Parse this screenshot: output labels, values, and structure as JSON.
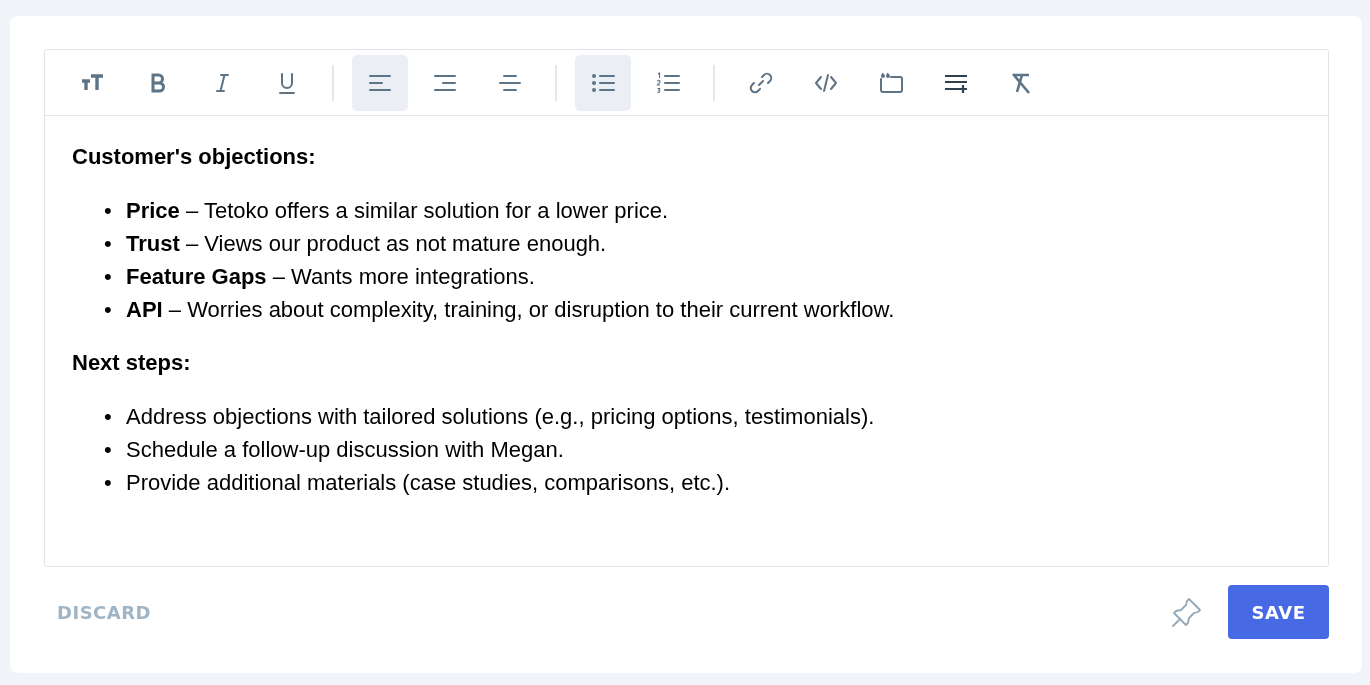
{
  "toolbar": {
    "groups": [
      {
        "buttons": [
          {
            "kind": "text-size",
            "selected": false
          },
          {
            "kind": "bold",
            "selected": false
          },
          {
            "kind": "italic",
            "selected": false
          },
          {
            "kind": "underline",
            "selected": false
          }
        ]
      },
      {
        "buttons": [
          {
            "kind": "align-left",
            "selected": true
          },
          {
            "kind": "align-right",
            "selected": false
          },
          {
            "kind": "align-center",
            "selected": false
          }
        ]
      },
      {
        "buttons": [
          {
            "kind": "bullet-list",
            "selected": true
          },
          {
            "kind": "numbered-list",
            "selected": false
          }
        ]
      },
      {
        "buttons": [
          {
            "kind": "link",
            "selected": false
          },
          {
            "kind": "code",
            "selected": false
          },
          {
            "kind": "quote",
            "selected": false
          },
          {
            "kind": "insert-line",
            "selected": false
          },
          {
            "kind": "clear-format",
            "selected": false
          }
        ]
      }
    ]
  },
  "content": [
    {
      "kind": "heading",
      "text": "Customer's objections:"
    },
    {
      "kind": "list",
      "items": [
        {
          "marker": "•",
          "text": "**Price** – Tetoko offers a similar solution for a lower price."
        },
        {
          "marker": "•",
          "text": "**Trust** – Views our product as not mature enough."
        },
        {
          "marker": "•",
          "text": "**Feature Gaps** – Wants more integrations."
        },
        {
          "marker": "•",
          "text": "**API** – Worries about complexity, training, or disruption to their current workflow."
        }
      ]
    },
    {
      "kind": "heading",
      "text": "Next steps:"
    },
    {
      "kind": "list",
      "items": [
        {
          "marker": "•",
          "text": "Address objections with tailored solutions (e.g., pricing options, testimonials)."
        },
        {
          "marker": "•",
          "text": "Schedule a follow-up discussion with Megan."
        },
        {
          "marker": "•",
          "text": "Provide additional materials (case studies, comparisons, etc.)."
        }
      ]
    }
  ],
  "footer": {
    "discard": "DISCARD",
    "save": "SAVE"
  }
}
